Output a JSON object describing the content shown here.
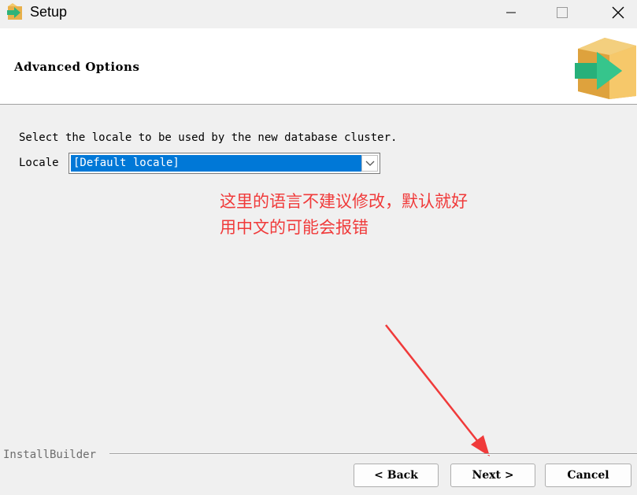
{
  "window": {
    "title": "Setup"
  },
  "header": {
    "title": "Advanced Options"
  },
  "main": {
    "prompt": "Select the locale to be used by the new database cluster.",
    "locale_label": "Locale",
    "locale_value": "[Default locale]"
  },
  "annotation": {
    "line1": "这里的语言不建议修改，默认就好",
    "line2": "用中文的可能会报错",
    "color": "#f03a3a"
  },
  "footer": {
    "brand": "InstallBuilder",
    "back_label": "< Back",
    "next_label": "Next >",
    "cancel_label": "Cancel"
  },
  "colors": {
    "selection": "#0078d7",
    "background": "#f0f0f0"
  }
}
